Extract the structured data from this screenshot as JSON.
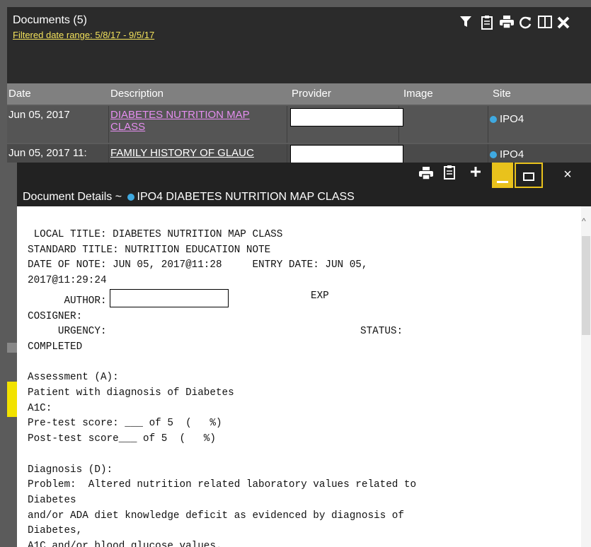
{
  "documents": {
    "title": "Documents (5)",
    "filter_text": "Filtered date range: 5/8/17 - 9/5/17",
    "columns": [
      "Date",
      "Description",
      "Provider",
      "Image",
      "Site"
    ],
    "rows": [
      {
        "date": "Jun 05, 2017",
        "description": "DIABETES NUTRITION MAP CLASS",
        "site": "IPO4"
      },
      {
        "date": "Jun 05, 2017 11:",
        "description": "FAMILY HISTORY OF GLAUC",
        "site": "IPO4"
      }
    ],
    "icons": [
      "filter-icon",
      "clipboard-icon",
      "print-icon",
      "refresh-icon",
      "expand-icon",
      "close-icon"
    ]
  },
  "dialog": {
    "title_prefix": "Document Details ~",
    "title_rest": "IPO4 DIABETES NUTRITION MAP CLASS",
    "close_label": "×",
    "note": {
      "l1": " LOCAL TITLE: DIABETES NUTRITION MAP CLASS",
      "l2": "STANDARD TITLE: NUTRITION EDUCATION NOTE",
      "l3": "DATE OF NOTE: JUN 05, 2017@11:28     ENTRY DATE: JUN 05,",
      "l4": "2017@11:29:24",
      "l5a": "      AUTHOR:",
      "l5b": "EXP",
      "l6": "COSIGNER:",
      "l7a": "     URGENCY:",
      "l7b": "STATUS:",
      "l8": "COMPLETED",
      "l9": "Assessment (A):",
      "l10": "Patient with diagnosis of Diabetes",
      "l11": "A1C:",
      "l12": "Pre-test score: ___ of 5  (   %)",
      "l13": "Post-test score___ of 5  (   %)",
      "l14": "Diagnosis (D):",
      "l15": "Problem:  Altered nutrition related laboratory values related to",
      "l16": "Diabetes",
      "l17": "and/or ADA diet knowledge deficit as evidenced by diagnosis of",
      "l18": "Diabetes,",
      "l19": "A1C and/or blood glucose values."
    }
  },
  "colors": {
    "filter_link": "#f3e25c",
    "desc_link": "#e58ef0",
    "site_dot": "#3fa9e0",
    "minimize_button": "#e9c21c"
  }
}
